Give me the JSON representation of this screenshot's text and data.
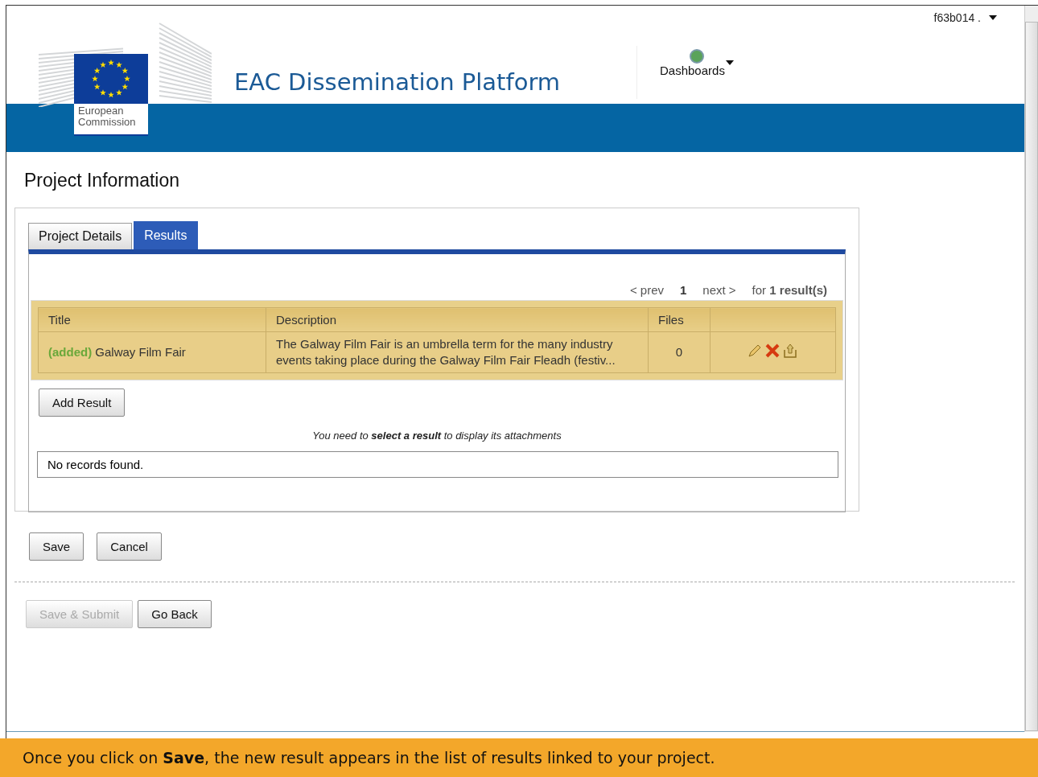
{
  "header": {
    "logo_text": "European Commission",
    "title": "EAC Dissemination Platform",
    "menu": "Dashboards",
    "user": "f63b014 ."
  },
  "page_title": "Project Information",
  "tabs": [
    {
      "label": "Project Details",
      "selected": false
    },
    {
      "label": "Results",
      "selected": true
    }
  ],
  "pagination": {
    "prev": "< prev",
    "page": "1",
    "next": "next >",
    "summary": "for **1 result(s)**"
  },
  "table": {
    "columns": [
      "Title",
      "Description",
      "Files",
      ""
    ],
    "rows": [
      {
        "status": "(added)",
        "title": "Galway Film Fair",
        "description": "The Galway Film Fair is an umbrella term for the many industry events taking place during the Galway Film Fair Fleadh (festiv...",
        "files": "0",
        "selected": true
      }
    ]
  },
  "add_button": "Add Result",
  "note": "You need to **select a result** to display its attachments",
  "attachments_empty": "No records found.",
  "form_buttons": [
    {
      "label": "Save",
      "disabled": false
    },
    {
      "label": "Cancel",
      "disabled": false
    }
  ],
  "nav_buttons": [
    {
      "label": "Save & Submit",
      "disabled": true
    },
    {
      "label": "Go Back",
      "disabled": false
    }
  ],
  "banner": "Once you click on **Save**, the new result appears in the list of results linked to your project."
}
